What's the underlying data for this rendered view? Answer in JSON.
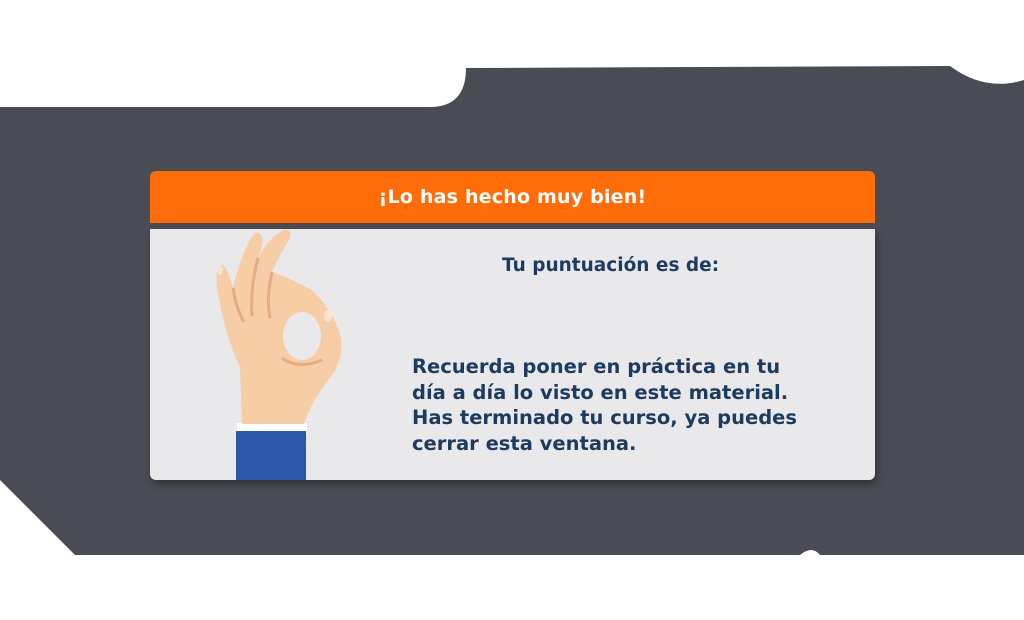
{
  "dialog": {
    "title": "¡Lo has hecho muy bien!",
    "score_label": "Tu puntuación es de:",
    "score_value": "",
    "message_lines": [
      "Recuerda poner en práctica en tu",
      "día a día lo visto en este material.",
      "Has terminado tu curso, ya puedes",
      "cerrar esta ventana."
    ]
  },
  "icons": {
    "illustration": "ok-hand-gesture-icon"
  },
  "colors": {
    "header": "#ff6c0a",
    "body": "#e9e9eb",
    "background_shape": "#4a4c55",
    "text": "#1d3b5e",
    "sleeve": "#2d58a7",
    "skin": "#f7cda6"
  }
}
